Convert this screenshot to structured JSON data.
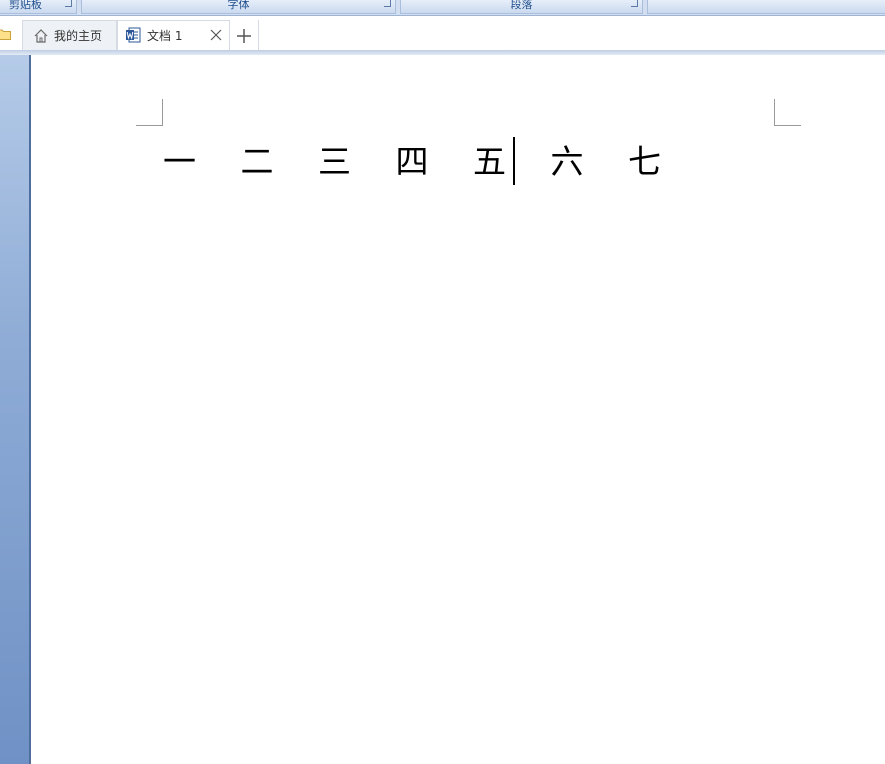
{
  "ribbon": {
    "groups": [
      "剪贴板",
      "字体",
      "段落",
      ""
    ]
  },
  "tabs": [
    {
      "label": "我的主页",
      "icon": "home-icon"
    },
    {
      "label": "文档 1",
      "icon": "word-doc-icon"
    }
  ],
  "document": {
    "text": "一 二 三 四 五 六 七"
  },
  "colors": {
    "ribbon_text": "#1f4e8c",
    "side_panel": "#6f91c5"
  }
}
